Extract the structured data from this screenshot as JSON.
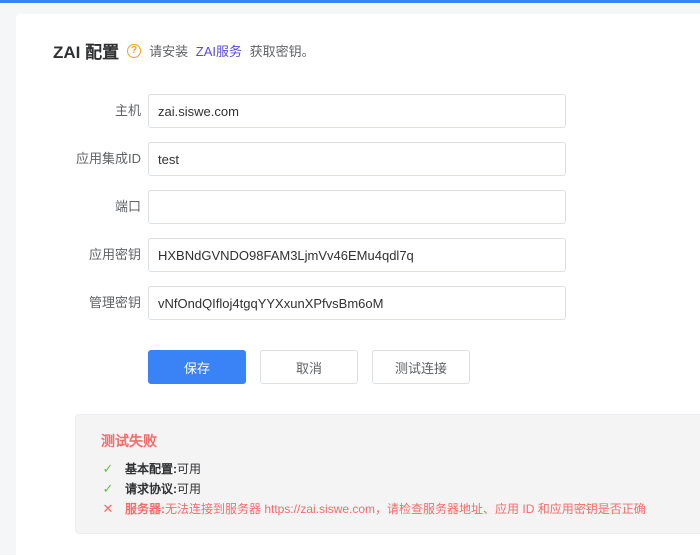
{
  "header": {
    "title": "ZAI 配置",
    "hint_prefix": "请安装",
    "hint_link": "ZAI服务",
    "hint_suffix": "获取密钥。"
  },
  "form": {
    "host": {
      "label": "主机",
      "value": "zai.siswe.com"
    },
    "app_id": {
      "label": "应用集成ID",
      "value": "test"
    },
    "port": {
      "label": "端口",
      "value": ""
    },
    "app_key": {
      "label": "应用密钥",
      "value": "HXBNdGVNDO98FAM3LjmVv46EMu4qdl7q"
    },
    "admin_key": {
      "label": "管理密钥",
      "value": "vNfOndQIfloj4tgqYYXxunXPfvsBm6oM"
    }
  },
  "actions": {
    "save": "保存",
    "cancel": "取消",
    "test": "测试连接"
  },
  "result": {
    "title": "测试失败",
    "checks": [
      {
        "name": "基本配置:",
        "value": "可用",
        "status": "ok"
      },
      {
        "name": "请求协议:",
        "value": "可用",
        "status": "ok"
      },
      {
        "name": "服务器:",
        "value": "无法连接到服务器 https://zai.siswe.com，请检查服务器地址、应用 ID 和应用密钥是否正确",
        "status": "fail"
      }
    ]
  },
  "colors": {
    "primary": "#3a83f7",
    "error": "#f56c6c",
    "success": "#67c23a",
    "warning": "#f0a020",
    "link": "#5b4bd6"
  },
  "icons": {
    "help": "help-circle-icon",
    "ok": "check-icon",
    "fail": "close-icon"
  }
}
